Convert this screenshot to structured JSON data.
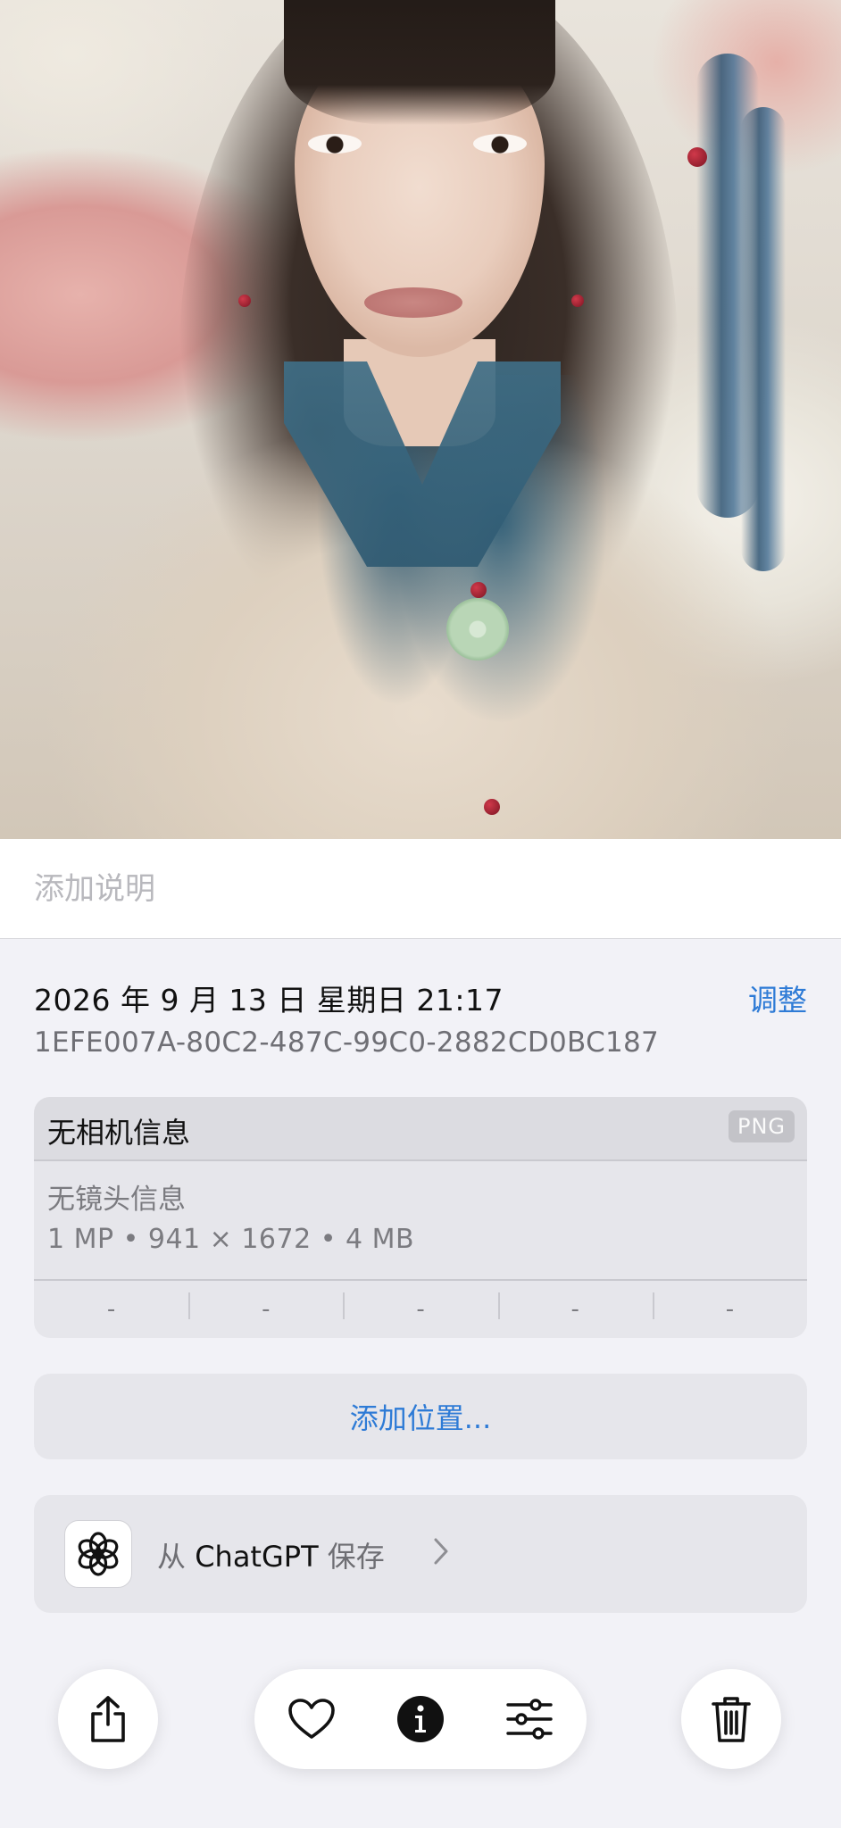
{
  "caption": {
    "placeholder": "添加说明",
    "value": ""
  },
  "info": {
    "datetime": "2026 年 9 月 13 日 星期日 21:17",
    "adjust_label": "调整",
    "file_id": "1EFE007A-80C2-487C-99C0-2882CD0BC187"
  },
  "camera": {
    "title": "无相机信息",
    "format": "PNG",
    "lens": "无镜头信息",
    "specs": "1 MP • 941 × 1672 • 4 MB",
    "exif": [
      "-",
      "-",
      "-",
      "-",
      "-"
    ]
  },
  "location": {
    "label": "添加位置..."
  },
  "source": {
    "prefix": "从",
    "app": "ChatGPT",
    "suffix": "保存",
    "icon": "chatgpt-logo"
  },
  "toolbar": {
    "share_icon": "share-icon",
    "favorite_icon": "heart-icon",
    "info_icon": "info-icon",
    "edit_icon": "sliders-icon",
    "delete_icon": "trash-icon"
  },
  "colors": {
    "accent": "#2e7bd6",
    "background": "#f2f2f7",
    "card": "#e6e6eb",
    "secondary_text": "#6e6e73"
  }
}
